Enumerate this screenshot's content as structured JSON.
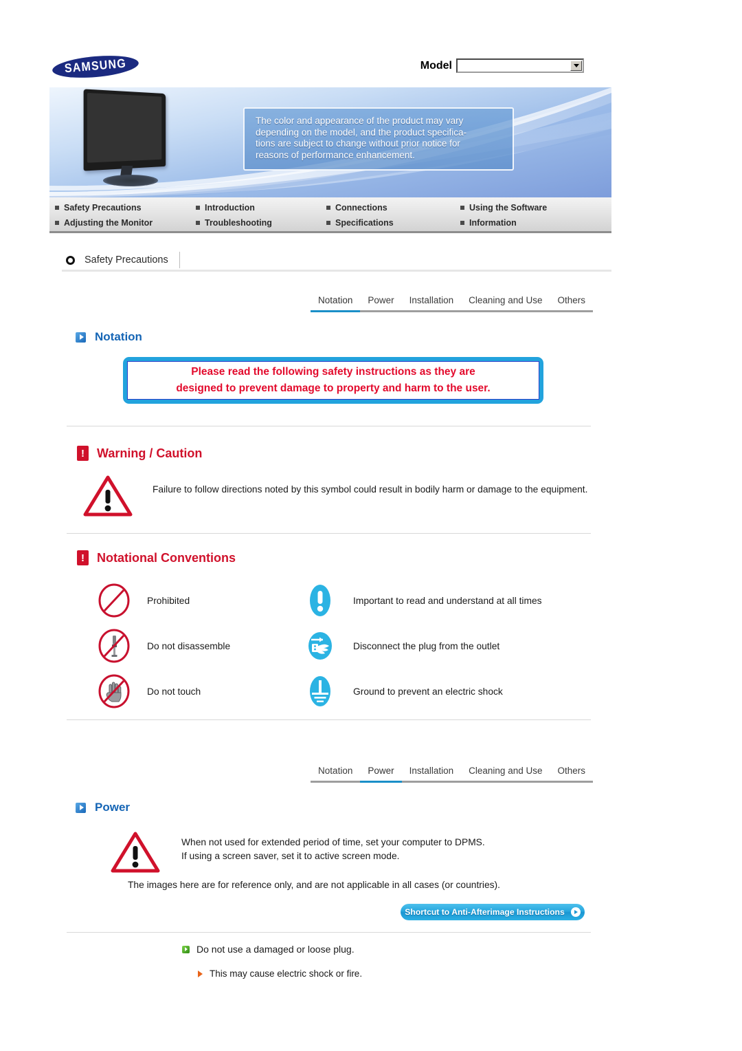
{
  "header": {
    "brand": "SAMSUNG",
    "model_label": "Model",
    "model_value": "",
    "model_placeholder": ""
  },
  "banner": {
    "notice_lines": [
      "The color and appearance of the product may vary",
      "depending on the model, and the product specifica-",
      "tions are subject to change without prior notice for",
      "reasons of performance enhancement."
    ]
  },
  "main_nav": {
    "items": [
      {
        "label": "Safety Precautions"
      },
      {
        "label": "Introduction"
      },
      {
        "label": "Connections"
      },
      {
        "label": "Using the Software"
      },
      {
        "label": "Adjusting the Monitor"
      },
      {
        "label": "Troubleshooting"
      },
      {
        "label": "Specifications"
      },
      {
        "label": "Information"
      }
    ]
  },
  "section": {
    "title": "Safety Precautions"
  },
  "subtabs_top": {
    "items": [
      {
        "label": "Notation",
        "active": true
      },
      {
        "label": "Power",
        "active": false
      },
      {
        "label": "Installation",
        "active": false
      },
      {
        "label": "Cleaning and Use",
        "active": false
      },
      {
        "label": "Others",
        "active": false
      }
    ]
  },
  "notation": {
    "heading": "Notation",
    "notice_line1": "Please read the following safety instructions as they are",
    "notice_line2": "designed to prevent damage to property and harm to the user."
  },
  "warning_caution": {
    "heading": "Warning / Caution",
    "body": "Failure to follow directions noted by this symbol could result in bodily harm or damage to the equipment."
  },
  "notational_conventions": {
    "heading": "Notational Conventions",
    "items": [
      {
        "icon": "prohibited-icon",
        "label": "Prohibited"
      },
      {
        "icon": "important-exclamation-icon",
        "label": "Important to read and understand at all times"
      },
      {
        "icon": "do-not-disassemble-icon",
        "label": "Do not disassemble"
      },
      {
        "icon": "disconnect-plug-icon",
        "label": "Disconnect the plug from the outlet"
      },
      {
        "icon": "do-not-touch-icon",
        "label": "Do not touch"
      },
      {
        "icon": "ground-icon",
        "label": "Ground to prevent an electric shock"
      }
    ]
  },
  "subtabs_bottom": {
    "items": [
      {
        "label": "Notation",
        "active": false
      },
      {
        "label": "Power",
        "active": true
      },
      {
        "label": "Installation",
        "active": false
      },
      {
        "label": "Cleaning and Use",
        "active": false
      },
      {
        "label": "Others",
        "active": false
      }
    ]
  },
  "power": {
    "heading": "Power",
    "warn_line1": "When not used for extended period of time, set your computer to DPMS.",
    "warn_line2": "If using a screen saver, set it to active screen mode.",
    "reference_note": "The images here are for reference only, and are not applicable in all cases (or countries).",
    "shortcut_button": "Shortcut to Anti-Afterimage Instructions",
    "bullet_1": "Do not use a damaged or loose plug.",
    "bullet_1_sub": "This may cause electric shock or fire."
  },
  "colors": {
    "brand_blue": "#1b2a80",
    "accent_blue": "#1a8fc8",
    "heading_blue": "#1565b5",
    "alert_red": "#d0112b",
    "notice_red": "#e30b2d",
    "cyan": "#22a3dd",
    "green": "#2d8a12",
    "orange": "#e8641a"
  }
}
